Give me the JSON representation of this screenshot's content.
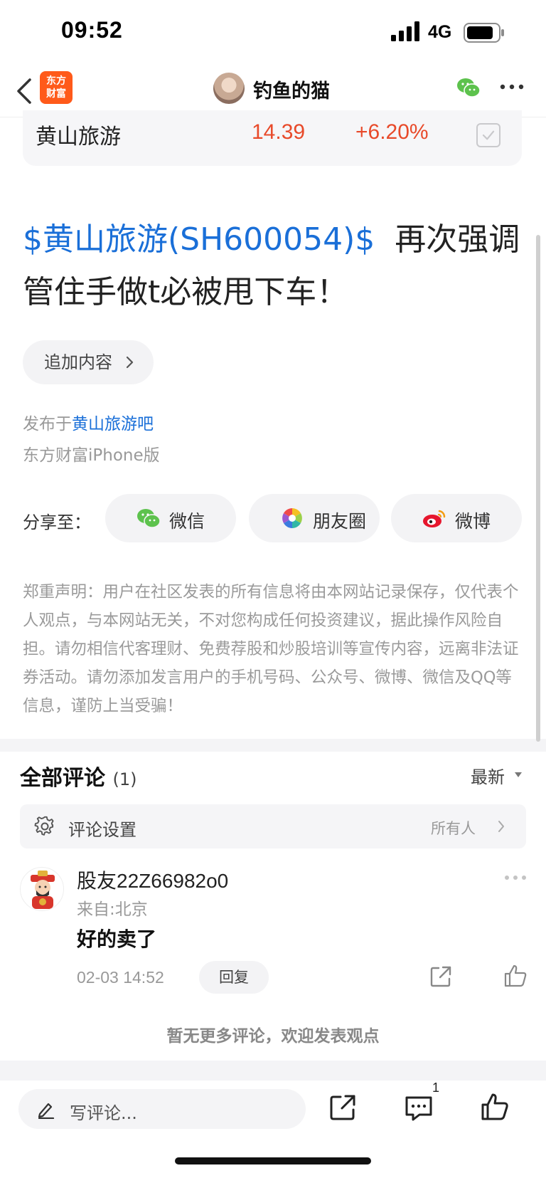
{
  "status_bar": {
    "time": "09:52",
    "network": "4G"
  },
  "nav": {
    "logo_line1": "东方",
    "logo_line2": "财富",
    "title": "钓鱼的猫"
  },
  "stock_card": {
    "name": "黄山旅游",
    "price": "14.39",
    "change": "+6.20%"
  },
  "post": {
    "stock_link": "$黄山旅游(SH600054)$",
    "text_part1": "  再次强调",
    "text_part2": "管住手做t必被甩下车！",
    "append_label": "追加内容",
    "publish_prefix": "发布于",
    "publish_bar": "黄山旅游吧",
    "source": "东方财富iPhone版"
  },
  "share": {
    "label": "分享至：",
    "buttons": [
      {
        "label": "微信",
        "icon": "wechat-icon"
      },
      {
        "label": "朋友圈",
        "icon": "moments-icon"
      },
      {
        "label": "微博",
        "icon": "weibo-icon"
      }
    ]
  },
  "disclaimer": "郑重声明：用户在社区发表的所有信息将由本网站记录保存，仅代表个人观点，与本网站无关，不对您构成任何投资建议，据此操作风险自担。请勿相信代客理财、免费荐股和炒股培训等宣传内容，远离非法证券活动。请勿添加发言用户的手机号码、公众号、微博、微信及QQ等信息，谨防上当受骗！",
  "comments": {
    "title": "全部评论",
    "count": "(1)",
    "sort": "最新",
    "settings_label": "评论设置",
    "settings_value": "所有人",
    "items": [
      {
        "user": "股友22Z66982o0",
        "location": "来自:北京",
        "text": "好的卖了",
        "time": "02-03 14:52",
        "reply_label": "回复"
      }
    ],
    "no_more": "暂无更多评论，欢迎发表观点"
  },
  "bottom_bar": {
    "placeholder": "写评论...",
    "comment_count": "1"
  },
  "colors": {
    "rise": "#e84a2a",
    "link": "#1a6fd8",
    "brand": "#ff5a1a"
  }
}
